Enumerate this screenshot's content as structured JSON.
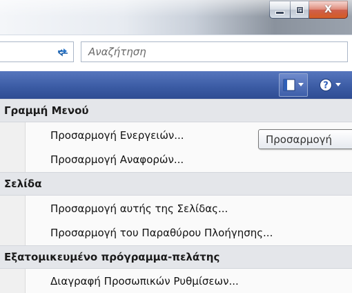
{
  "window": {
    "minimize_icon": "minimize-icon",
    "maximize_icon": "restore-icon",
    "close_glyph": "X"
  },
  "navbar": {
    "refresh_icon": "refresh-icon",
    "search_placeholder": "Αναζήτηση"
  },
  "commandbar": {
    "layout_icon": "layout-icon",
    "help_icon": "help-icon",
    "accent": "#3a5aa3"
  },
  "menu": {
    "sections": [
      {
        "header": "Γραμμή Μενού",
        "items": [
          "Προσαρμογή Ενεργειών...",
          "Προσαρμογή Αναφορών..."
        ]
      },
      {
        "header": "Σελίδα",
        "items": [
          "Προσαρμογή αυτής της Σελίδας...",
          "Προσαρμογή του Παραθύρου Πλοήγησης..."
        ]
      },
      {
        "header": "Εξατομικευμένο πρόγραμμα-πελάτης",
        "items": [
          "Διαγραφή Προσωπικών Ρυθμίσεων..."
        ]
      }
    ]
  },
  "tooltip": {
    "text": "Προσαρμογή"
  }
}
